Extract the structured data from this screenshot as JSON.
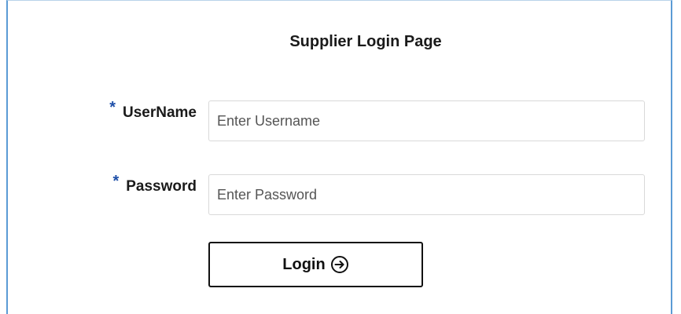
{
  "page": {
    "title": "Supplier Login Page"
  },
  "form": {
    "required_marker": "*",
    "username": {
      "label": "UserName",
      "value": "",
      "placeholder": "Enter Username"
    },
    "password": {
      "label": "Password",
      "value": "",
      "placeholder": "Enter Password"
    },
    "login": {
      "label": "Login",
      "icon": "arrow-circle-right-icon"
    }
  },
  "colors": {
    "frame_border": "#5b9bd5",
    "required_marker": "#1e4fa8",
    "button_border": "#111111",
    "field_border": "#d9d9d9"
  }
}
